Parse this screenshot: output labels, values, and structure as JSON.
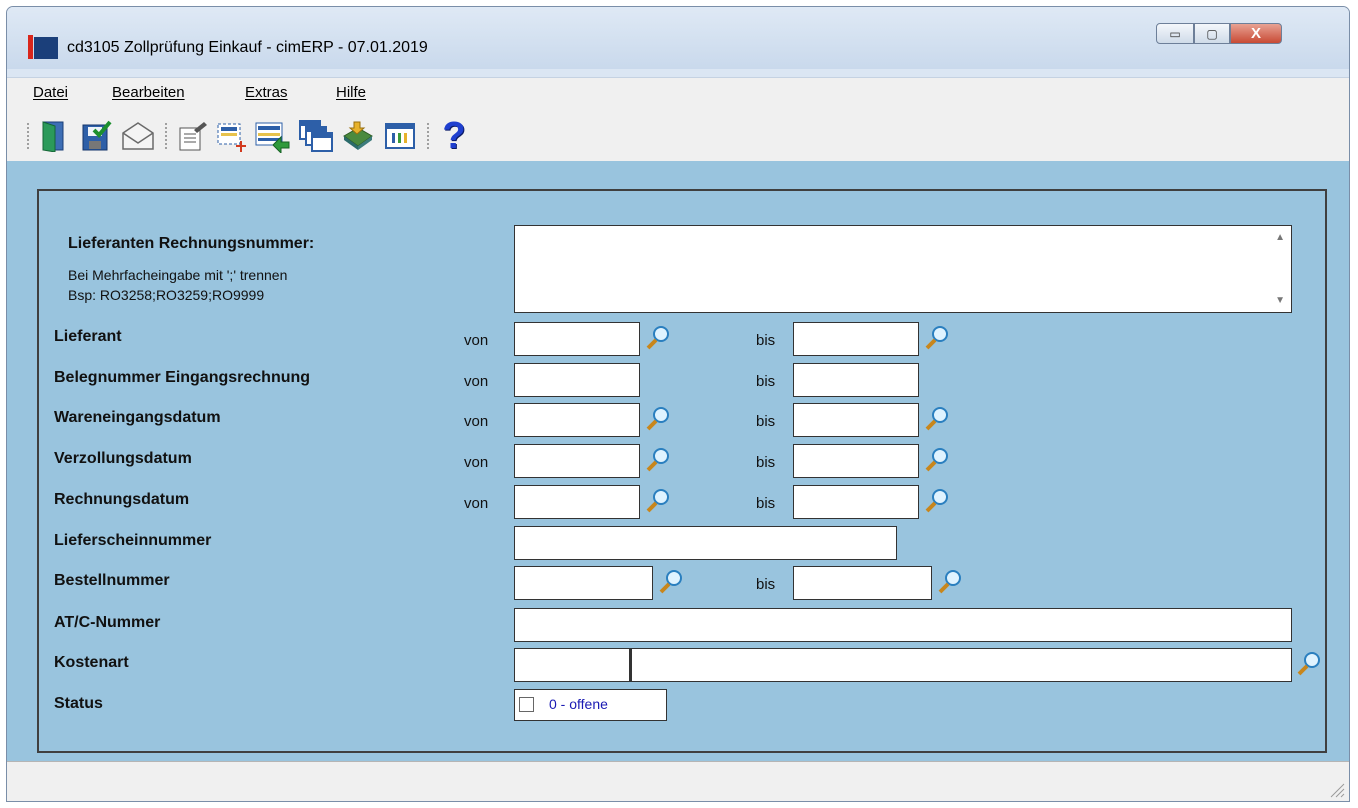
{
  "window": {
    "title": "cd3105 Zollprüfung Einkauf - cimERP - 07.01.2019",
    "minimize_glyph": "▭",
    "maximize_glyph": "▢",
    "close_glyph": "X"
  },
  "menu": {
    "items": [
      "Datei",
      "Bearbeiten",
      "Extras",
      "Hilfe"
    ]
  },
  "toolbar": {
    "icons": [
      "exit-door-icon",
      "save-check-icon",
      "mail-envelope-icon",
      "edit-document-icon",
      "new-selection-icon",
      "import-list-icon",
      "windows-cascade-icon",
      "book-export-icon",
      "grid-table-icon",
      "help-question-icon"
    ],
    "help_glyph": "?"
  },
  "form": {
    "invoice_number": {
      "label": "Lieferanten Rechnungsnummer:",
      "hint1": "Bei Mehrfacheingabe mit ';' trennen",
      "hint2": "Bsp: RO3258;RO3259;RO9999",
      "value": ""
    },
    "from_label": "von",
    "to_label": "bis",
    "rows": {
      "lieferant": "Lieferant",
      "belegnummer": "Belegnummer Eingangsrechnung",
      "wareneingang": "Wareneingangsdatum",
      "verzollung": "Verzollungsdatum",
      "rechnung": "Rechnungsdatum",
      "lieferschein": "Lieferscheinnummer",
      "bestell": "Bestellnummer",
      "atc": "AT/C-Nummer",
      "kostenart": "Kostenart",
      "status": "Status"
    },
    "status_value": "0 - offene"
  },
  "colors": {
    "client_bg": "#99c4de",
    "status_text": "#1a1ab3"
  }
}
